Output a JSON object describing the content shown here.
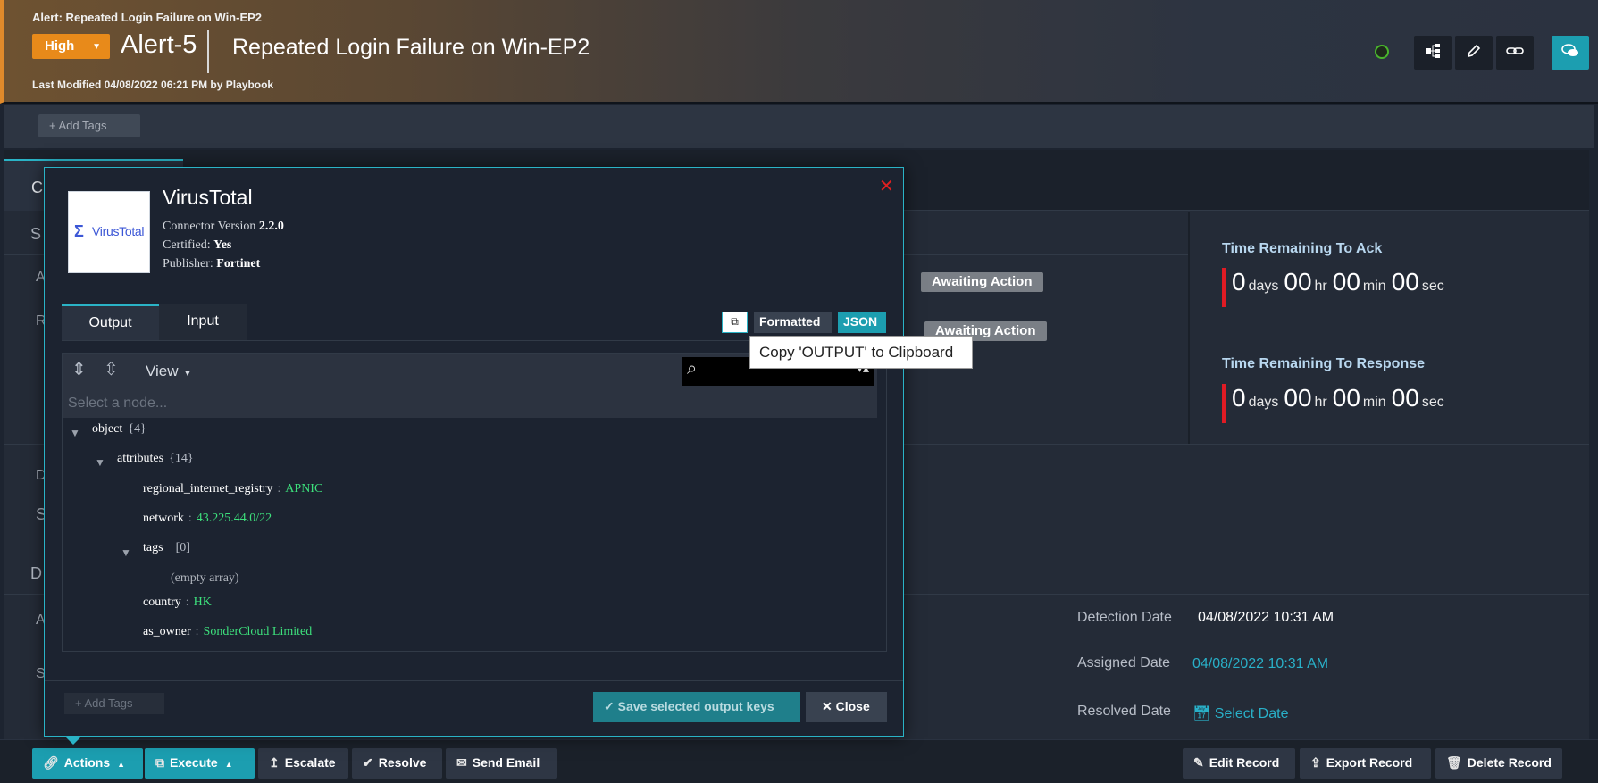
{
  "header": {
    "breadcrumb": "Alert: Repeated Login Failure on Win-EP2",
    "severity": "High",
    "alert_id": "Alert-5",
    "title": "Repeated Login Failure on Win-EP2",
    "last_modified": "Last Modified 04/08/2022 06:21 PM by Playbook",
    "icons": [
      "status-indicator-icon",
      "hierarchy-icon",
      "pencil-icon",
      "link-icon",
      "chat-icon"
    ]
  },
  "tags": {
    "add_label": "+ Add Tags"
  },
  "background": {
    "tab_letter": "C",
    "side_letters": [
      "S",
      "A",
      "R",
      "D",
      "S",
      "D",
      "A",
      "S"
    ],
    "status_badges": [
      "Awaiting Action",
      "Awaiting Action"
    ],
    "sla": [
      {
        "title": "Time Remaining To Ack",
        "days": "0",
        "hr": "00",
        "min": "00",
        "sec": "00"
      },
      {
        "title": "Time Remaining To Response",
        "days": "0",
        "hr": "00",
        "min": "00",
        "sec": "00"
      }
    ],
    "units": {
      "days": "days",
      "hr": "hr",
      "min": "min",
      "sec": "sec"
    },
    "dates": [
      {
        "label": "Detection Date",
        "value": "04/08/2022 10:31 AM"
      },
      {
        "label": "Assigned Date",
        "value": "04/08/2022 10:31 AM"
      },
      {
        "label": "Resolved Date",
        "value": "Select Date"
      }
    ]
  },
  "modal": {
    "logo_text": "VirusTotal",
    "connector_name": "VirusTotal",
    "version_label": "Connector Version",
    "version": "2.2.0",
    "certified_label": "Certified:",
    "certified": "Yes",
    "publisher_label": "Publisher:",
    "publisher": "Fortinet",
    "tabs": [
      "Output",
      "Input"
    ],
    "format_buttons": [
      "Formatted",
      "JSON"
    ],
    "tooltip": "Copy 'OUTPUT' to Clipboard",
    "view_label": "View",
    "node_placeholder": "Select a node...",
    "tree": {
      "root": {
        "key": "object",
        "count": "{4}"
      },
      "attributes": {
        "key": "attributes",
        "count": "{14}"
      },
      "rir": {
        "key": "regional_internet_registry",
        "value": "APNIC"
      },
      "network": {
        "key": "network",
        "value": "43.225.44.0/22"
      },
      "tags": {
        "key": "tags",
        "count": "[0]"
      },
      "empty": "(empty array)",
      "country": {
        "key": "country",
        "value": "HK"
      },
      "as_owner": {
        "key": "as_owner",
        "value": "SonderCloud Limited"
      }
    },
    "add_tags": "+ Add Tags",
    "save_label": "Save selected output keys",
    "close_label": "Close"
  },
  "bottombar": {
    "actions": "Actions",
    "execute": "Execute",
    "escalate": "Escalate",
    "resolve": "Resolve",
    "send_email": "Send Email",
    "edit_record": "Edit Record",
    "export_record": "Export Record",
    "delete_record": "Delete Record"
  },
  "colors": {
    "accent": "#2ab3c6",
    "severity": "#e88a1a",
    "value_green": "#3de07c",
    "sla_bar": "#e01b24"
  }
}
